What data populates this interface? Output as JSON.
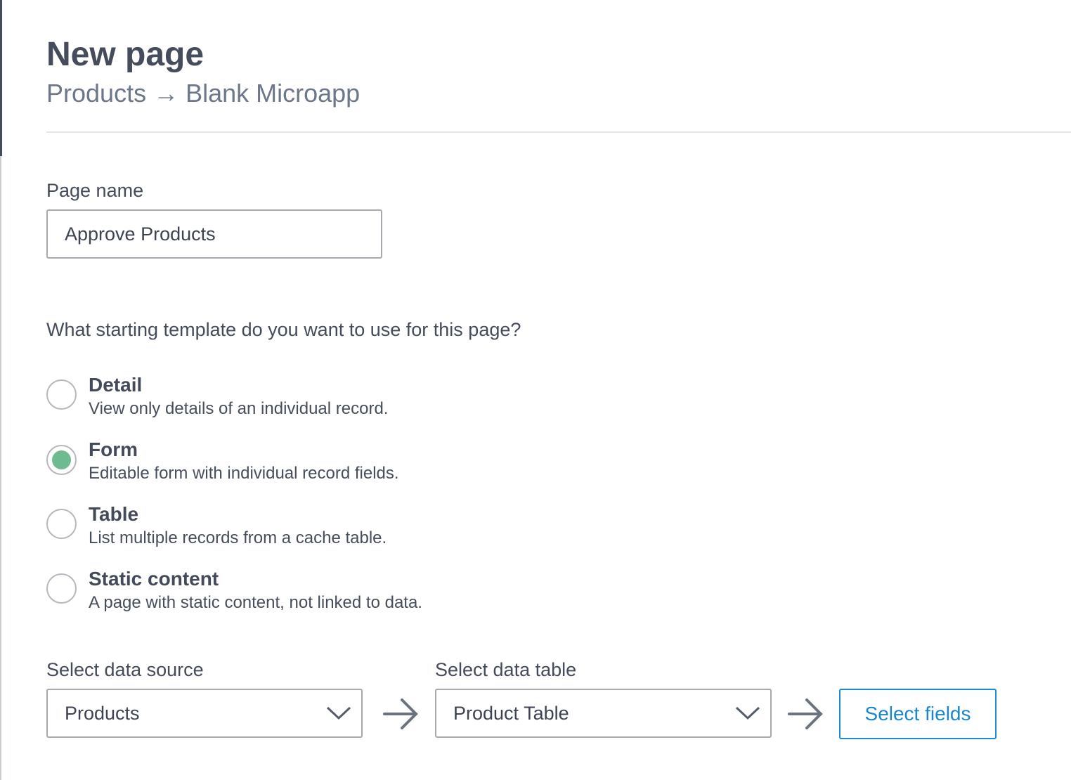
{
  "header": {
    "title": "New page",
    "breadcrumb": "Products → Blank Microapp"
  },
  "page_name": {
    "label": "Page name",
    "value": "Approve Products"
  },
  "template": {
    "question": "What starting template do you want to use for this page?",
    "options": [
      {
        "title": "Detail",
        "description": "View only details of an individual record.",
        "selected": false
      },
      {
        "title": "Form",
        "description": "Editable form with individual record fields.",
        "selected": true
      },
      {
        "title": "Table",
        "description": "List multiple records from a cache table.",
        "selected": false
      },
      {
        "title": "Static content",
        "description": "A page with static content, not linked to data.",
        "selected": false
      }
    ]
  },
  "data_source": {
    "label": "Select data source",
    "value": "Products"
  },
  "data_table": {
    "label": "Select data table",
    "value": "Product Table"
  },
  "select_fields_label": "Select fields",
  "colors": {
    "accent": "#1a87cc",
    "radio_selected": "#6dbb8e"
  }
}
